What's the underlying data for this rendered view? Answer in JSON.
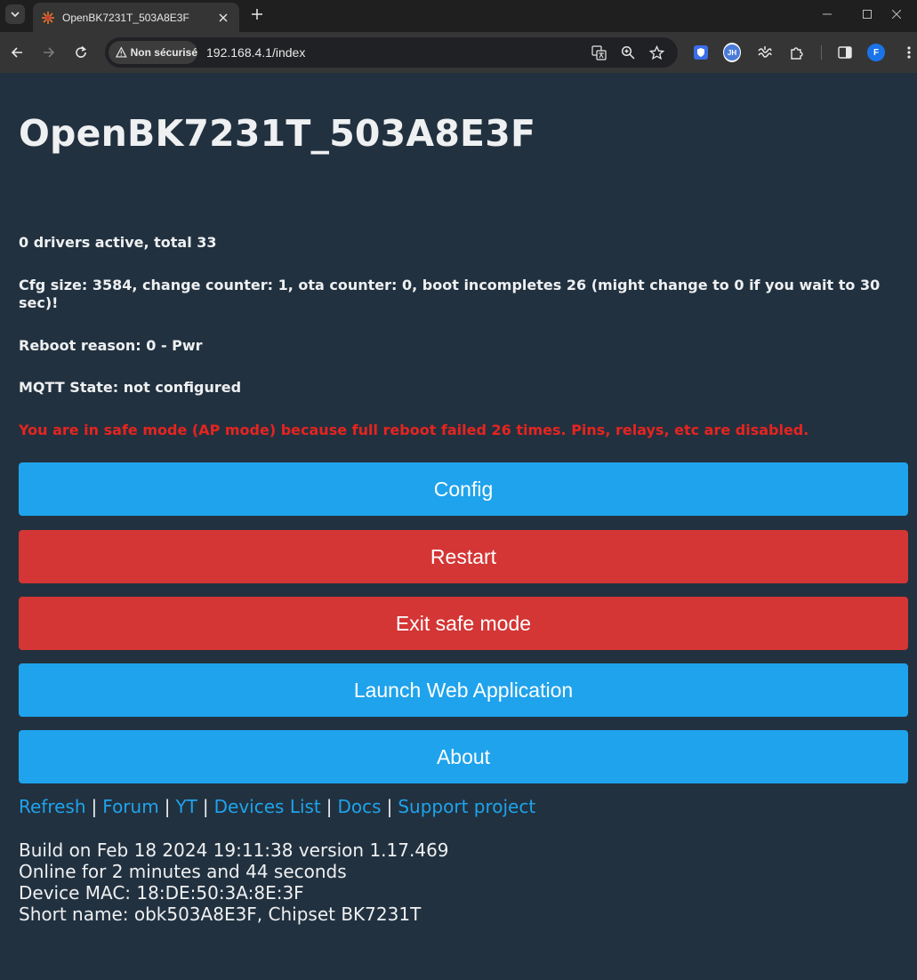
{
  "browser": {
    "tab_title": "OpenBK7231T_503A8E3F",
    "security_label": "Non sécurisé",
    "url": "192.168.4.1/index",
    "profile_initial": "F",
    "extension_initials": "JH"
  },
  "page": {
    "title": "OpenBK7231T_503A8E3F",
    "info_lines": [
      "0 drivers active, total 33",
      "Cfg size: 3584, change counter: 1, ota counter: 0, boot incompletes 26 (might change to 0 if you wait to 30 sec)!",
      "Reboot reason: 0 - Pwr",
      "MQTT State: not configured"
    ],
    "warning": "You are in safe mode (AP mode) because full reboot failed 26 times. Pins, relays, etc are disabled.",
    "buttons": [
      {
        "label": "Config",
        "color": "#1fa3ec"
      },
      {
        "label": "Restart",
        "color": "#d43535"
      },
      {
        "label": "Exit safe mode",
        "color": "#d43535"
      },
      {
        "label": "Launch Web Application",
        "color": "#1fa3ec"
      },
      {
        "label": "About",
        "color": "#1fa3ec"
      }
    ],
    "links": [
      "Refresh",
      "Forum",
      "YT",
      "Devices List",
      "Docs",
      "Support project"
    ],
    "link_separator": "|",
    "footer": [
      "Build on Feb 18 2024 19:11:38 version 1.17.469",
      "Online for 2 minutes and 44 seconds",
      "Device MAC: 18:DE:50:3A:8E:3F",
      "Short name: obk503A8E3F, Chipset BK7231T"
    ]
  },
  "colors": {
    "page_background": "#22313f",
    "accent_blue": "#1fa3ec",
    "danger_red": "#d43535",
    "warning_text": "#e52420"
  }
}
